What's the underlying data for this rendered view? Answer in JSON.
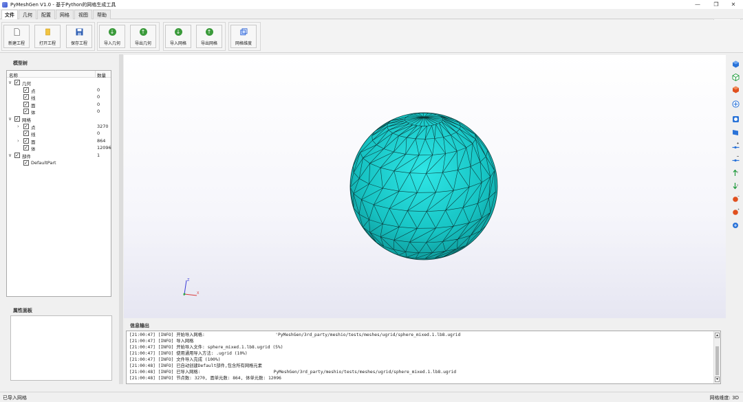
{
  "window": {
    "title": "PyMeshGen V1.0 - 基于Python的网格生成工具",
    "minimize": "—",
    "restore": "❐",
    "close": "✕"
  },
  "menu_tabs": [
    {
      "label": "文件"
    },
    {
      "label": "几何"
    },
    {
      "label": "配置"
    },
    {
      "label": "网格"
    },
    {
      "label": "视图"
    },
    {
      "label": "帮助"
    }
  ],
  "ribbon_collapse": "^",
  "ribbon": {
    "new_project": "新建工程",
    "open_project": "打开工程",
    "save_project": "保存工程",
    "import_geometry": "导入几何",
    "export_geometry": "导出几何",
    "import_mesh": "导入网格",
    "export_mesh": "导出网格",
    "mesh_dimension": "网格维度"
  },
  "model_tree": {
    "title": "模型树",
    "col_name": "名称",
    "col_count": "数量",
    "rows": [
      {
        "name": "几何",
        "count": "",
        "expand": "∨",
        "level": 0
      },
      {
        "name": "点",
        "count": "0",
        "expand": "",
        "level": 1
      },
      {
        "name": "线",
        "count": "0",
        "expand": "",
        "level": 1
      },
      {
        "name": "面",
        "count": "0",
        "expand": "",
        "level": 1
      },
      {
        "name": "体",
        "count": "0",
        "expand": "",
        "level": 1
      },
      {
        "name": "网格",
        "count": "",
        "expand": "∨",
        "level": 0
      },
      {
        "name": "点",
        "count": "3270",
        "expand": "›",
        "level": 1
      },
      {
        "name": "线",
        "count": "0",
        "expand": "",
        "level": 1
      },
      {
        "name": "面",
        "count": "864",
        "expand": "›",
        "level": 1
      },
      {
        "name": "体",
        "count": "12096",
        "expand": "",
        "level": 1
      },
      {
        "name": "部件",
        "count": "1",
        "expand": "∨",
        "level": 0
      },
      {
        "name": "DefaultPart",
        "count": "",
        "expand": "",
        "level": 1
      }
    ]
  },
  "property_panel": {
    "title": "属性面板"
  },
  "log": {
    "title": "信息输出",
    "lines": [
      "[21:00:47] [INFO] 开始导入网格:                           'PyMeshGen/3rd_party/meshio/tests/meshes/ugrid/sphere_mixed.1.lb8.ugrid",
      "[21:00:47] [INFO] 导入网格",
      "[21:00:47] [INFO] 开始导入文件: sphere_mixed.1.lb8.ugrid (5%)",
      "[21:00:47] [INFO] 使用通用导入方法: .ugrid (10%)",
      "[21:00:47] [INFO] 文件导入完成 (100%)",
      "[21:00:48] [INFO] 已自动创建Default部件,包含所有网格元素",
      "[21:00:48] [INFO] 已导入网格:                            PyMeshGen/3rd_party/meshio/tests/meshes/ugrid/sphere_mixed.1.lb8.ugrid",
      "[21:00:48] [INFO] 节点数: 3270, 面单元数: 864, 体单元数: 12096"
    ]
  },
  "axes": {
    "z": "Z",
    "x": "X"
  },
  "status": {
    "left": "已导入网格",
    "right": "网格维度: 3D"
  },
  "colors": {
    "sphere": "#17c4c4",
    "edge": "#0b3a3a"
  }
}
